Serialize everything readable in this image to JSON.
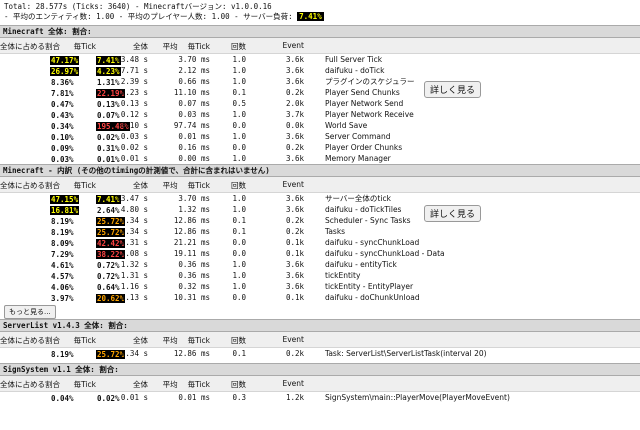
{
  "header": {
    "line1": "Total: 28.577s (Ticks: 3640)  - Minecraftバージョン: v1.0.0.16",
    "line2_pre": " -  平均のエンティティ数: 1.00 - 平均のプレイヤー人数: 1.00 - サーバー負荷: ",
    "load": "7.41%"
  },
  "columns": {
    "pct": "全体に占める割合",
    "tick_each": "毎Tick",
    "tick_small": "毎Tick",
    "total": "全体",
    "avg": "平均",
    "avg_small": "毎Tick",
    "count": "回数",
    "event": "Event"
  },
  "sections": [
    {
      "title": "Minecraft 全体: 割合:",
      "rows": [
        {
          "pct": "47.17%",
          "tick": "7.41%",
          "total": "13.48 s",
          "avg": "3.70 ms",
          "cnt": "1.0",
          "evt": "3.6k",
          "name": "Full Server Tick",
          "pct_style": "yellow",
          "tick_style": "yellow"
        },
        {
          "pct": "26.97%",
          "tick": "4.23%",
          "total": "7.71 s",
          "avg": "2.12 ms",
          "cnt": "1.0",
          "evt": "3.6k",
          "name": "daifuku - doTick",
          "pct_style": "yellow",
          "tick_style": "yellow"
        },
        {
          "pct": "8.36%",
          "tick": "1.31%",
          "total": "2.39 s",
          "avg": "0.66 ms",
          "cnt": "1.0",
          "evt": "3.6k",
          "name": "プラグインのスケジュラー",
          "pct_style": "",
          "tick_style": ""
        },
        {
          "pct": "7.81%",
          "tick": "22.19%",
          "total": "2.23 s",
          "avg": "11.10 ms",
          "cnt": "0.1",
          "evt": "0.2k",
          "name": "Player Send Chunks",
          "pct_style": "",
          "tick_style": "red"
        },
        {
          "pct": "0.47%",
          "tick": "0.13%",
          "total": "0.13 s",
          "avg": "0.07 ms",
          "cnt": "0.5",
          "evt": "2.0k",
          "name": "Player Network Send",
          "pct_style": "",
          "tick_style": ""
        },
        {
          "pct": "0.43%",
          "tick": "0.07%",
          "total": "0.12 s",
          "avg": "0.03 ms",
          "cnt": "1.0",
          "evt": "3.7k",
          "name": "Player Network Receive",
          "pct_style": "",
          "tick_style": ""
        },
        {
          "pct": "0.34%",
          "tick": "195.48%",
          "total": "0.10 s",
          "avg": "97.74 ms",
          "cnt": "0.0",
          "evt": "0.0k",
          "name": "World Save",
          "pct_style": "",
          "tick_style": "red"
        },
        {
          "pct": "0.10%",
          "tick": "0.02%",
          "total": "0.03 s",
          "avg": "0.01 ms",
          "cnt": "1.0",
          "evt": "3.6k",
          "name": "Server Command",
          "pct_style": "",
          "tick_style": ""
        },
        {
          "pct": "0.09%",
          "tick": "0.31%",
          "total": "0.02 s",
          "avg": "0.16 ms",
          "cnt": "0.0",
          "evt": "0.2k",
          "name": "Player Order Chunks",
          "pct_style": "",
          "tick_style": ""
        },
        {
          "pct": "0.03%",
          "tick": "0.01%",
          "total": "0.01 s",
          "avg": "0.00 ms",
          "cnt": "1.0",
          "evt": "3.6k",
          "name": "Memory Manager",
          "pct_style": "",
          "tick_style": ""
        }
      ],
      "more_button": "詳しく見る"
    },
    {
      "title": "Minecraft - 内訳 (その他のtimingの計測値で、合計に含まれはいません)",
      "rows": [
        {
          "pct": "47.15%",
          "tick": "7.41%",
          "total": "13.47 s",
          "avg": "3.70 ms",
          "cnt": "1.0",
          "evt": "3.6k",
          "name": "サーバー全体のtick",
          "pct_style": "yellow",
          "tick_style": "yellow"
        },
        {
          "pct": "16.81%",
          "tick": "2.64%",
          "total": "4.80 s",
          "avg": "1.32 ms",
          "cnt": "1.0",
          "evt": "3.6k",
          "name": "daifuku - doTickTiles",
          "pct_style": "yellow",
          "tick_style": ""
        },
        {
          "pct": "8.19%",
          "tick": "25.72%",
          "total": "2.34 s",
          "avg": "12.86 ms",
          "cnt": "0.1",
          "evt": "0.2k",
          "name": "Scheduler - Sync Tasks",
          "pct_style": "",
          "tick_style": "orange"
        },
        {
          "pct": "8.19%",
          "tick": "25.72%",
          "total": "2.34 s",
          "avg": "12.86 ms",
          "cnt": "0.1",
          "evt": "0.2k",
          "name": "Tasks",
          "pct_style": "",
          "tick_style": "orange"
        },
        {
          "pct": "8.09%",
          "tick": "42.42%",
          "total": "2.31 s",
          "avg": "21.21 ms",
          "cnt": "0.0",
          "evt": "0.1k",
          "name": "daifuku - syncChunkLoad",
          "pct_style": "",
          "tick_style": "red"
        },
        {
          "pct": "7.29%",
          "tick": "38.22%",
          "total": "2.08 s",
          "avg": "19.11 ms",
          "cnt": "0.0",
          "evt": "0.1k",
          "name": "daifuku - syncChunkLoad - Data",
          "pct_style": "",
          "tick_style": "red"
        },
        {
          "pct": "4.61%",
          "tick": "0.72%",
          "total": "1.32 s",
          "avg": "0.36 ms",
          "cnt": "1.0",
          "evt": "3.6k",
          "name": "daifuku - entityTick",
          "pct_style": "",
          "tick_style": ""
        },
        {
          "pct": "4.57%",
          "tick": "0.72%",
          "total": "1.31 s",
          "avg": "0.36 ms",
          "cnt": "1.0",
          "evt": "3.6k",
          "name": "tickEntity",
          "pct_style": "",
          "tick_style": ""
        },
        {
          "pct": "4.06%",
          "tick": "0.64%",
          "total": "1.16 s",
          "avg": "0.32 ms",
          "cnt": "1.0",
          "evt": "3.6k",
          "name": "tickEntity - EntityPlayer",
          "pct_style": "",
          "tick_style": ""
        },
        {
          "pct": "3.97%",
          "tick": "20.62%",
          "total": "1.13 s",
          "avg": "10.31 ms",
          "cnt": "0.0",
          "evt": "0.1k",
          "name": "daifuku - doChunkUnload",
          "pct_style": "",
          "tick_style": "orange"
        }
      ],
      "more_button": "詳しく見る",
      "more_link": "もっと見る..."
    },
    {
      "title": "ServerList v1.4.3 全体: 割合:",
      "rows": [
        {
          "pct": "8.19%",
          "tick": "25.72%",
          "total": "2.34 s",
          "avg": "12.86 ms",
          "cnt": "0.1",
          "evt": "0.2k",
          "name": "Task: ServerList\\ServerListTask(interval 20)",
          "pct_style": "",
          "tick_style": "orange"
        }
      ]
    },
    {
      "title": "SignSystem v1.1 全体: 割合:",
      "rows": [
        {
          "pct": "0.04%",
          "tick": "0.02%",
          "total": "0.01 s",
          "avg": "0.01 ms",
          "cnt": "0.3",
          "evt": "1.2k",
          "name": "SignSystem\\main::PlayerMove(PlayerMoveEvent)",
          "pct_style": "",
          "tick_style": ""
        }
      ]
    }
  ]
}
